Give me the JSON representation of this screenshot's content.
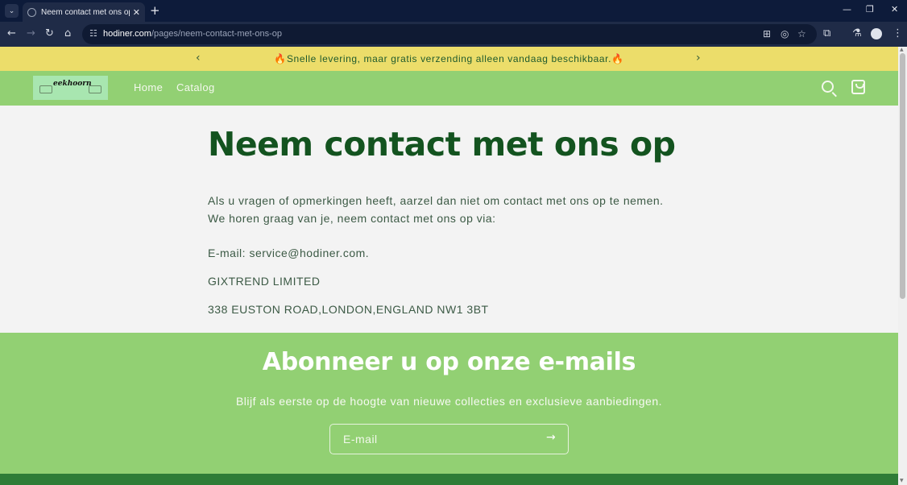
{
  "browser": {
    "tab_title": "Neem contact met ons op – hodiner",
    "tab_close": "✕",
    "new_tab": "+",
    "window_controls": {
      "minimize": "—",
      "restore": "❐",
      "close": "✕"
    },
    "url_host": "hodiner.com",
    "url_path": "/pages/neem-contact-met-ons-op",
    "icons": [
      "back-icon",
      "forward-icon",
      "reload-icon",
      "home-icon",
      "site-info-icon",
      "translate-icon",
      "eye-off-icon",
      "bookmark-star-icon",
      "extensions-icon",
      "labs-icon",
      "profile-icon",
      "menu-icon"
    ]
  },
  "announcement": {
    "text": "🔥Snelle levering, maar gratis verzending alleen vandaag beschikbaar.🔥",
    "prev": "‹",
    "next": "›"
  },
  "header": {
    "logo_text": "eekhoorn",
    "nav": [
      "Home",
      "Catalog"
    ]
  },
  "contact": {
    "title": "Neem contact met ons op",
    "intro_line1": "Als u vragen of opmerkingen heeft, aarzel dan niet om contact met ons op te nemen.",
    "intro_line2": "We horen graag van je, neem contact met ons op via:",
    "email": "E-mail: service@hodiner.com.",
    "company": "GIXTREND LIMITED",
    "address": "338 EUSTON ROAD,LONDON,ENGLAND NW1 3BT"
  },
  "newsletter": {
    "title": "Abonneer u op onze e-mails",
    "text": "Blijf als eerste op de hoogte van nieuwe collecties en exclusieve aanbiedingen.",
    "placeholder": "E-mail",
    "submit_arrow": "→"
  },
  "colors": {
    "announcement_bg": "#ecdd6a",
    "header_bg": "#92d073",
    "heading_green": "#13531f",
    "footer_green": "#2e7c37"
  }
}
